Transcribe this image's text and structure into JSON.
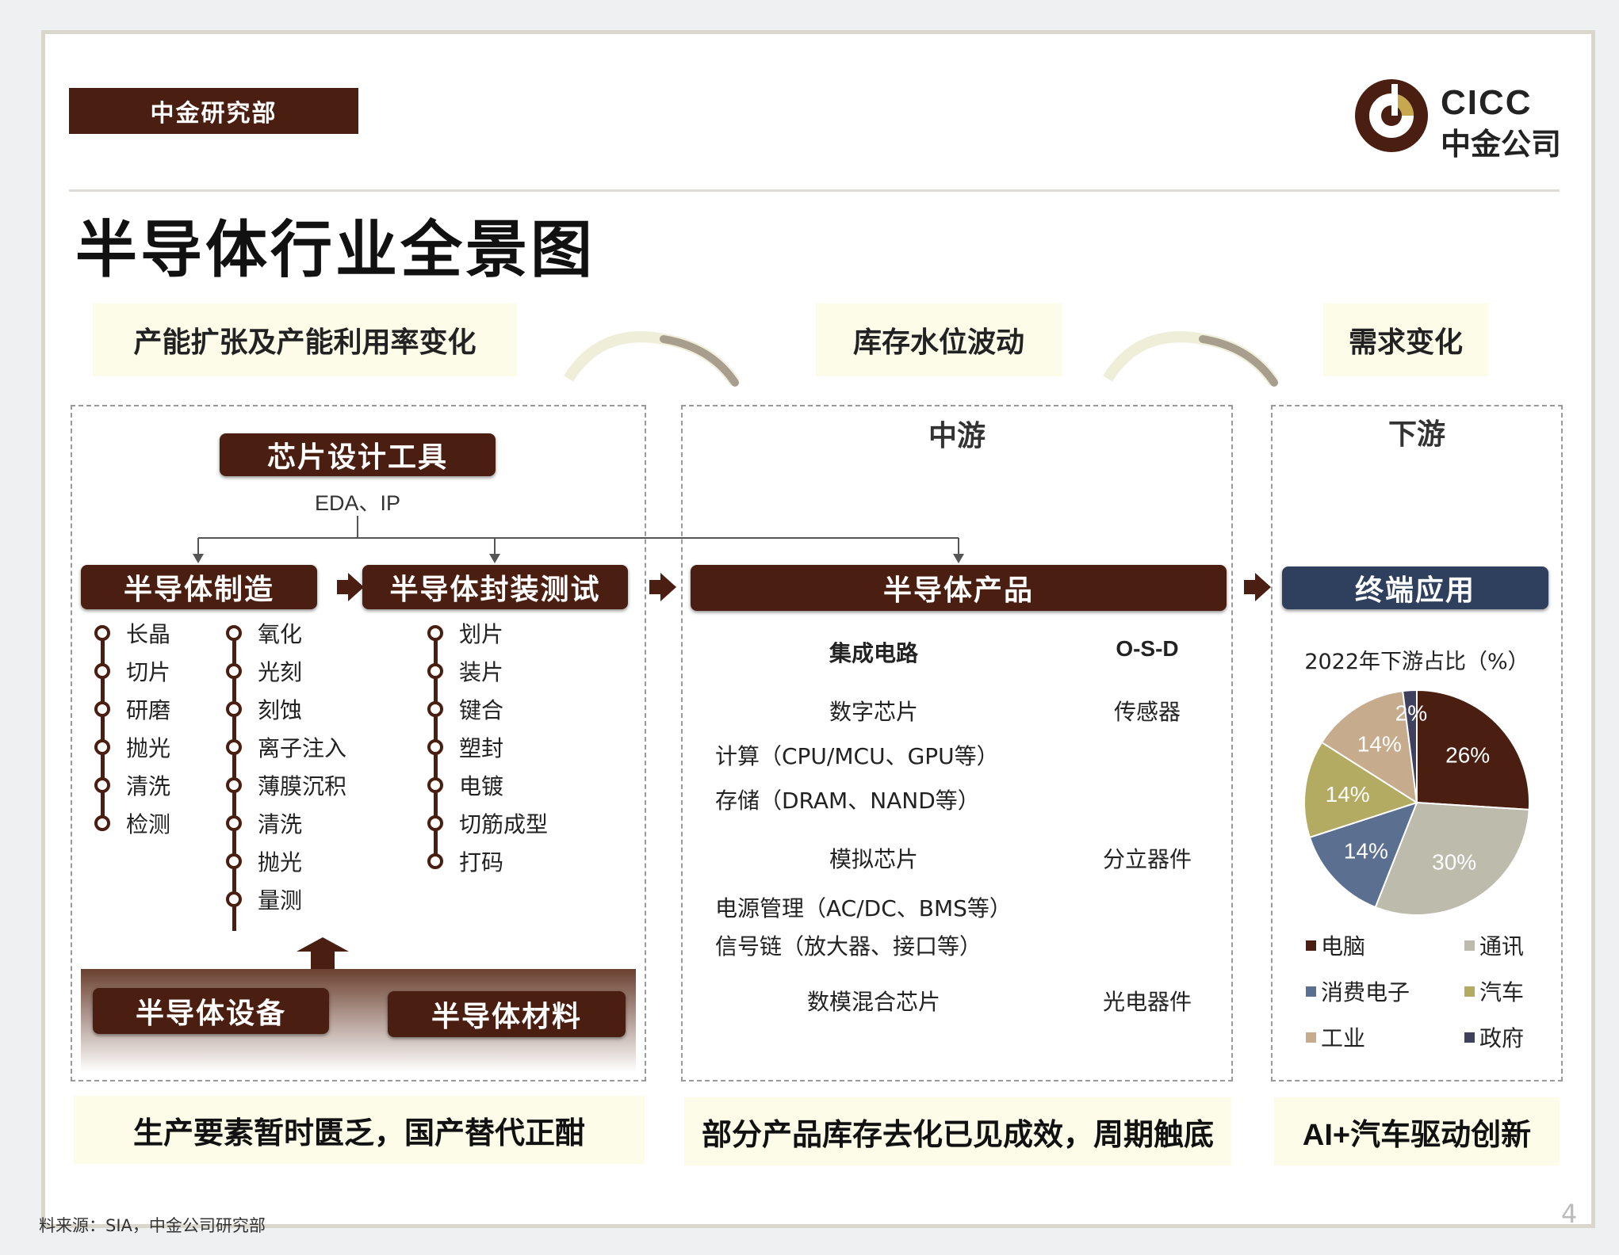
{
  "header": {
    "dept_label": "中金研究部",
    "logo_en": "CICC",
    "logo_cn": "中金公司",
    "title": "半导体行业全景图"
  },
  "themes": {
    "capacity": "产能扩张及产能利用率变化",
    "inventory": "库存水位波动",
    "demand": "需求变化"
  },
  "upstream": {
    "design_tool": "芯片设计工具",
    "design_tool_sub": "EDA、IP",
    "manufacturing": "半导体制造",
    "packaging": "半导体封装测试",
    "mfg_steps_a": [
      "长晶",
      "切片",
      "研磨",
      "抛光",
      "清洗",
      "检测"
    ],
    "mfg_steps_b": [
      "氧化",
      "光刻",
      "刻蚀",
      "离子注入",
      "薄膜沉积",
      "清洗",
      "抛光",
      "量测"
    ],
    "pkg_steps": [
      "划片",
      "装片",
      "键合",
      "塑封",
      "电镀",
      "切筋成型",
      "打码"
    ],
    "equipment": "半导体设备",
    "materials": "半导体材料"
  },
  "midstream": {
    "label": "中游",
    "bar": "半导体产品",
    "col_left_header": "集成电路",
    "col_right_header": "O-S-D",
    "digital": "数字芯片",
    "sensor": "传感器",
    "compute": "计算（CPU/MCU、GPU等）",
    "storage": "存储（DRAM、NAND等）",
    "analog": "模拟芯片",
    "discrete": "分立器件",
    "power": "电源管理（AC/DC、BMS等）",
    "signal": "信号链（放大器、接口等）",
    "mixed": "数模混合芯片",
    "opto": "光电器件"
  },
  "downstream": {
    "label": "下游",
    "bar": "终端应用"
  },
  "chart_data": {
    "type": "pie",
    "title": "2022年下游占比（%）",
    "slices": [
      {
        "label": "电脑",
        "value": 26,
        "text": "26%",
        "color": "#4a1f11"
      },
      {
        "label": "通讯",
        "value": 30,
        "text": "30%",
        "color": "#bdbbab"
      },
      {
        "label": "消费电子",
        "value": 14,
        "text": "14%",
        "color": "#5b7090"
      },
      {
        "label": "汽车",
        "value": 14,
        "text": "14%",
        "color": "#b3ab62"
      },
      {
        "label": "工业",
        "value": 14,
        "text": "14%",
        "color": "#c6ab8d"
      },
      {
        "label": "政府",
        "value": 2,
        "text": "2%",
        "color": "#3f3f5e"
      }
    ]
  },
  "bottom": {
    "left": "生产要素暂时匮乏，国产替代正酣",
    "mid": "部分产品库存去化已见成效，周期触底",
    "right": "AI+汽车驱动创新"
  },
  "footer": {
    "source": "料来源：SIA，中金公司研究部",
    "page": "4"
  }
}
